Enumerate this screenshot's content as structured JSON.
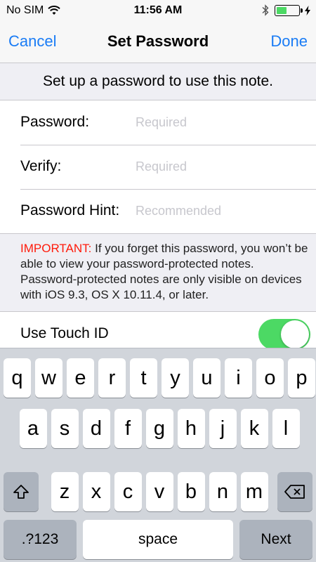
{
  "status": {
    "carrier": "No SIM",
    "time": "11:56 AM",
    "battery_level": 0.45,
    "battery_color": "#4cd964"
  },
  "nav": {
    "cancel": "Cancel",
    "title": "Set Password",
    "done": "Done"
  },
  "header": "Set up a password to use this note.",
  "form": {
    "password": {
      "label": "Password:",
      "placeholder": "Required"
    },
    "verify": {
      "label": "Verify:",
      "placeholder": "Required"
    },
    "hint": {
      "label": "Password Hint:",
      "placeholder": "Recommended"
    }
  },
  "info": {
    "important": "IMPORTANT:",
    "text": " If you forget this password, you won’t be able to view your password-protected notes. Password-protected notes are only visible on devices with iOS 9.3, OS X 10.11.4, or later."
  },
  "touch_id": {
    "label": "Use Touch ID",
    "enabled": true
  },
  "keyboard": {
    "row1": [
      "q",
      "w",
      "e",
      "r",
      "t",
      "y",
      "u",
      "i",
      "o",
      "p"
    ],
    "row2": [
      "a",
      "s",
      "d",
      "f",
      "g",
      "h",
      "j",
      "k",
      "l"
    ],
    "row3": [
      "z",
      "x",
      "c",
      "v",
      "b",
      "n",
      "m"
    ],
    "shift_icon": "shift-icon",
    "delete_icon": "delete-icon",
    "numbers": ".?123",
    "space": "space",
    "next": "Next"
  },
  "colors": {
    "accent": "#1a7cf5",
    "important": "#ff1a0a",
    "toggle_on": "#4cd964"
  }
}
